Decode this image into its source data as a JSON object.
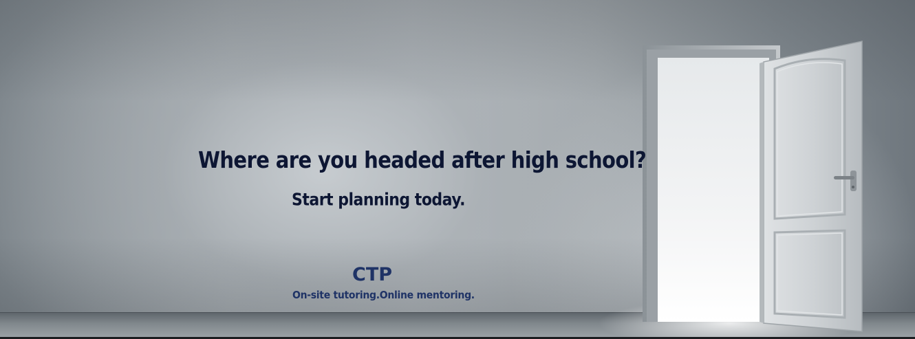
{
  "banner": {
    "headline": "Where are you headed after high school?",
    "subline": "Start planning today.",
    "logo": "CTP",
    "tagline": "On-site tutoring.Online mentoring."
  },
  "colors": {
    "text": "#0d1633",
    "brand": "#1f3366",
    "wall": "#a6acb0",
    "door_light": "#eef0f2"
  },
  "icons": {
    "door": "open-door-icon",
    "handle": "door-handle-icon"
  }
}
